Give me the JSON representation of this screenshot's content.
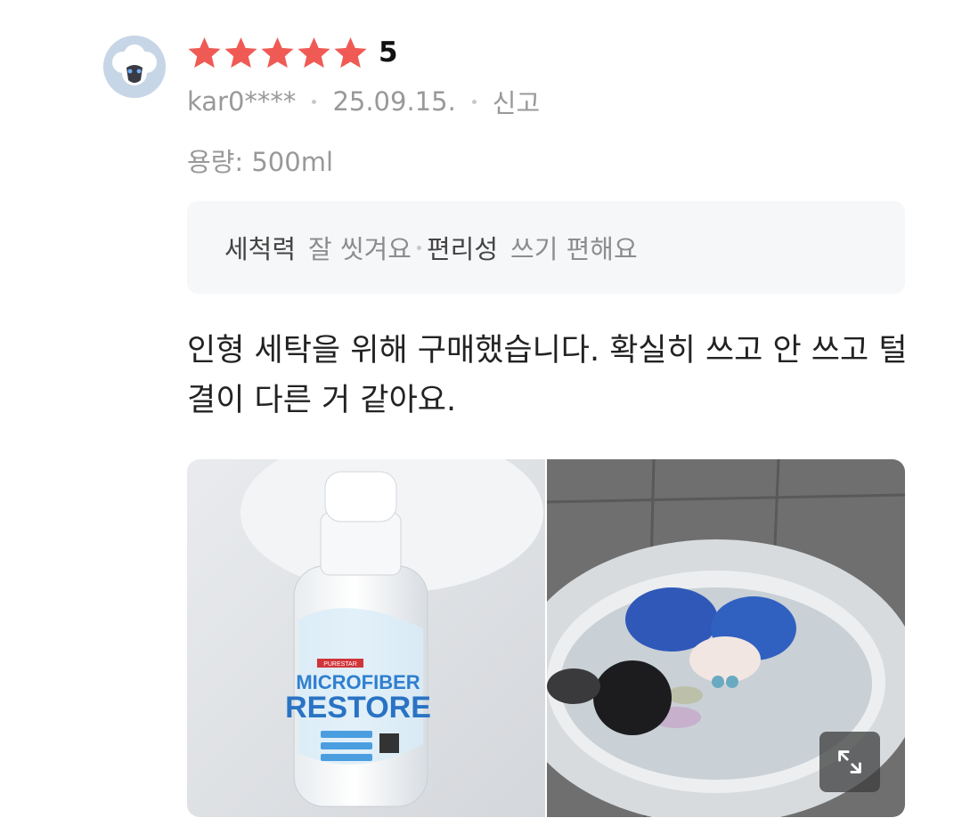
{
  "review": {
    "rating": "5",
    "stars_filled": 5,
    "star_color": "#f05a55",
    "user": "kar0****",
    "date": "25.09.15.",
    "report_label": "신고",
    "option": "용량: 500ml",
    "summary": [
      {
        "key": "세척력",
        "value": "잘 씻겨요"
      },
      {
        "key": "편리성",
        "value": "쓰기 편해요"
      }
    ],
    "text": "인형 세탁을 위해 구매했습니다. 확실히 쓰고 안 쓰고 털결이 다른 거 같아요."
  },
  "photos": {
    "bottle_label_brand": "PURESTAR",
    "bottle_label_line1": "MICROFIBER",
    "bottle_label_line2": "RESTORE"
  }
}
